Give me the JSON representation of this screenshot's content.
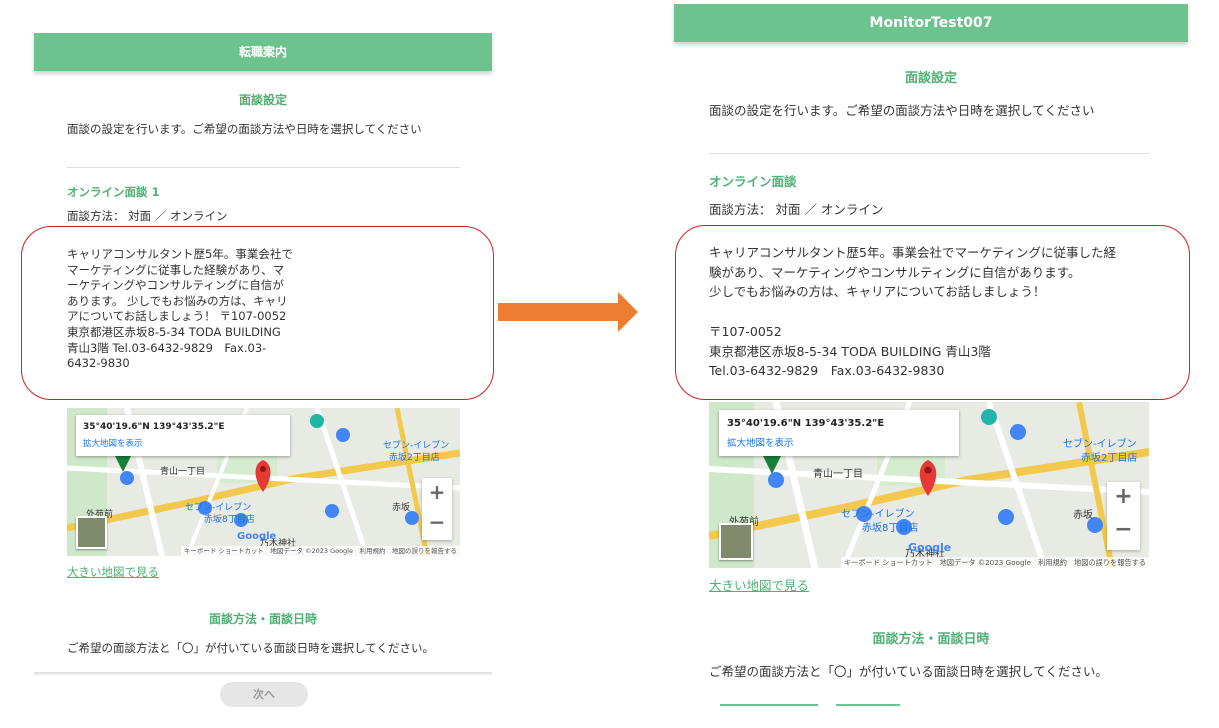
{
  "left": {
    "header_title": "転職案内",
    "section_title": "面談設定",
    "intro": "面談の設定を行います。ご希望の面談方法や日時を選択してください",
    "interview_title": "オンライン面談 1",
    "method_line": "面談方法： 対面 ／ オンライン",
    "description_lines": [
      "キャリアコンサルタント歴5年。事業会社で",
      "マーケティングに従事した経験があり、マ",
      "ーケティングやコンサルティングに自信が",
      "あります。 少しでもお悩みの方は、キャリ",
      "アについてお話しましょう！ 〒107-0052",
      "東京都港区赤坂8-5-34 TODA BUILDING",
      "青山3階 Tel.03-6432-9829　Fax.03-",
      "6432-9830"
    ],
    "map": {
      "coordinates": "35°40'19.6\"N 139°43'35.2\"E",
      "view_larger": "拡大地図を表示",
      "zoom_in": "+",
      "zoom_out": "−",
      "footer": "キーボード ショートカット　地図データ ©2023 Google　利用規約　地図の誤りを報告する",
      "google": "Google",
      "labels": {
        "aoyama": "青山一丁目",
        "seven1": "セブン-イレブン",
        "seven1b": "赤坂2丁目店",
        "seven2": "セブン-イレブン",
        "seven2b": "赤坂8丁目店",
        "gaien": "外苑前",
        "akasaka": "赤坂",
        "nogi": "乃木神社"
      }
    },
    "big_map_link": "大きい地図で見る",
    "method_section_title": "面談方法・面談日時",
    "method_instruction": "ご希望の面談方法と「〇」が付いている面談日時を選択してください。",
    "next_button": "次へ"
  },
  "right": {
    "header_title": "MonitorTest007",
    "section_title": "面談設定",
    "intro": "面談の設定を行います。ご希望の面談方法や日時を選択してください",
    "interview_title": "オンライン面談",
    "method_line": "面談方法： 対面 ／ オンライン",
    "description_lines": [
      "キャリアコンサルタント歴5年。事業会社でマーケティングに従事した経",
      "験があり、マーケティングやコンサルティングに自信があります。",
      "少しでもお悩みの方は、キャリアについてお話しましょう！",
      "",
      "〒107-0052",
      "東京都港区赤坂8-5-34 TODA BUILDING 青山3階",
      "Tel.03-6432-9829　Fax.03-6432-9830"
    ],
    "map": {
      "coordinates": "35°40'19.6\"N 139°43'35.2\"E",
      "view_larger": "拡大地図を表示",
      "zoom_in": "+",
      "zoom_out": "−",
      "footer": "キーボード ショートカット　地図データ ©2023 Google　利用規約　地図の誤りを報告する",
      "google": "Google",
      "labels": {
        "aoyama": "青山一丁目",
        "seven1": "セブン-イレブン",
        "seven1b": "赤坂2丁目店",
        "seven2": "セブン-イレブン",
        "seven2b": "赤坂8丁目店",
        "gaien": "外苑前",
        "akasaka": "赤坂",
        "nogi": "乃木神社"
      }
    },
    "big_map_link": "大きい地図で見る",
    "method_section_title": "面談方法・面談日時",
    "method_instruction": "ご希望の面談方法と「〇」が付いている面談日時を選択してください。"
  },
  "colors": {
    "header_green": "#6cc38d",
    "title_green": "#4fb074",
    "highlight_red": "#d62020",
    "arrow_orange": "#ed7d31"
  }
}
